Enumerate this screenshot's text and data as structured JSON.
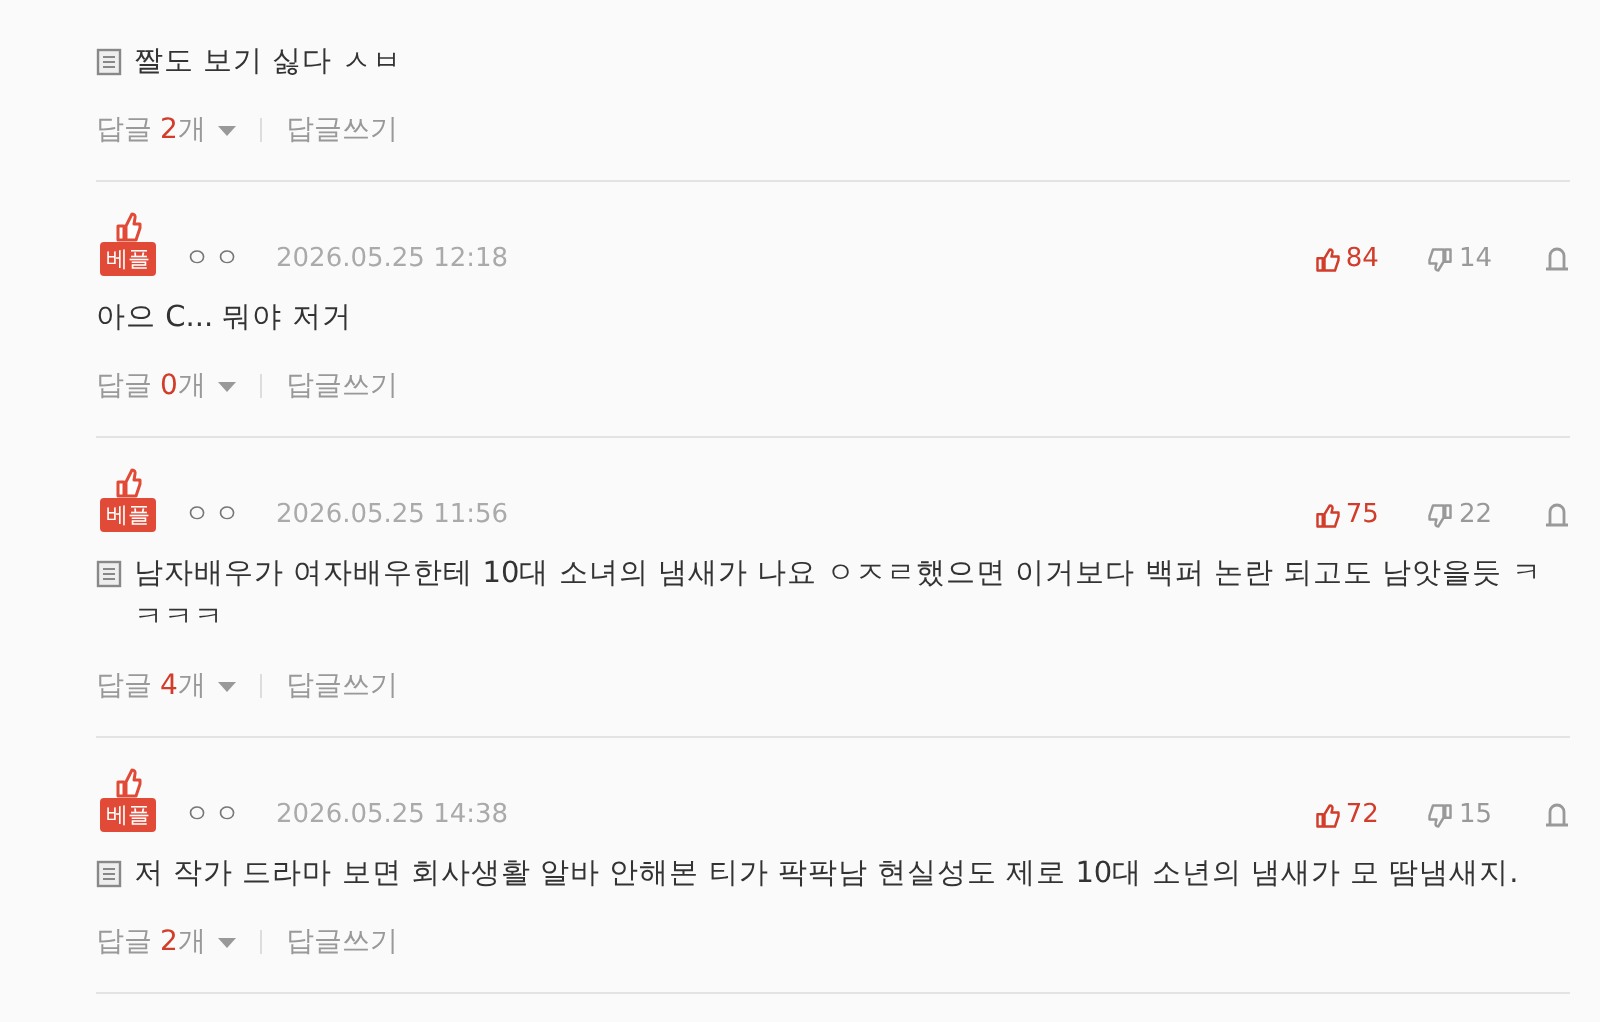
{
  "comments": [
    {
      "best": false,
      "attachment": true,
      "text": "짤도 보기 싫다 ㅅㅂ",
      "replies": {
        "label": "답글",
        "count": "2",
        "unit": "개"
      },
      "write_label": "답글쓰기"
    },
    {
      "best": true,
      "badge": "베플",
      "author": "ㅇㅇ",
      "date": "2026.05.25 12:18",
      "attachment": false,
      "text": "아으 C... 뭐야 저거",
      "likes": "84",
      "dislikes": "14",
      "replies": {
        "label": "답글",
        "count": "0",
        "unit": "개"
      },
      "write_label": "답글쓰기"
    },
    {
      "best": true,
      "badge": "베플",
      "author": "ㅇㅇ",
      "date": "2026.05.25 11:56",
      "attachment": true,
      "text": "남자배우가 여자배우한테 10대 소녀의 냄새가 나요 ㅇㅈㄹ했으면 이거보다 백퍼 논란 되고도 남앗을듯 ㅋㅋㅋㅋ",
      "likes": "75",
      "dislikes": "22",
      "replies": {
        "label": "답글",
        "count": "4",
        "unit": "개"
      },
      "write_label": "답글쓰기"
    },
    {
      "best": true,
      "badge": "베플",
      "author": "ㅇㅇ",
      "date": "2026.05.25 14:38",
      "attachment": true,
      "text": "저 작가 드라마 보면 회사생활 알바 안해본 티가 팍팍남 현실성도 제로 10대 소년의 냄새가 모 땀냄새지.",
      "likes": "72",
      "dislikes": "15",
      "replies": {
        "label": "답글",
        "count": "2",
        "unit": "개"
      },
      "write_label": "답글쓰기"
    }
  ]
}
